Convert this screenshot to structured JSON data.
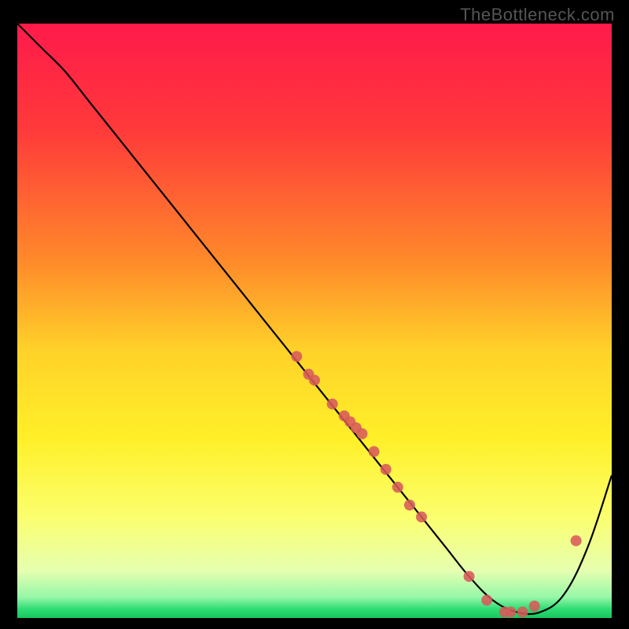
{
  "watermark": "TheBottleneck.com",
  "chart_data": {
    "type": "line",
    "title": "",
    "xlabel": "",
    "ylabel": "",
    "xlim": [
      0,
      100
    ],
    "ylim": [
      0,
      100
    ],
    "gradient_stops": [
      {
        "offset": 0.0,
        "color": "#ff1a4b"
      },
      {
        "offset": 0.18,
        "color": "#ff3a3a"
      },
      {
        "offset": 0.4,
        "color": "#ff8a2a"
      },
      {
        "offset": 0.55,
        "color": "#ffd229"
      },
      {
        "offset": 0.7,
        "color": "#fff029"
      },
      {
        "offset": 0.83,
        "color": "#fbff6e"
      },
      {
        "offset": 0.92,
        "color": "#e6ffb0"
      },
      {
        "offset": 0.965,
        "color": "#96f7a8"
      },
      {
        "offset": 0.985,
        "color": "#2edc74"
      },
      {
        "offset": 1.0,
        "color": "#18c75e"
      }
    ],
    "series": [
      {
        "name": "bottleneck-curve",
        "x": [
          0,
          4,
          8,
          12,
          16,
          20,
          24,
          28,
          32,
          36,
          40,
          44,
          48,
          52,
          56,
          60,
          64,
          68,
          72,
          76,
          80,
          84,
          88,
          92,
          96,
          100
        ],
        "y": [
          100,
          96,
          92,
          87,
          82,
          77,
          72,
          67,
          62,
          57,
          52,
          47,
          42,
          37,
          32,
          27,
          22,
          17,
          12,
          7,
          3,
          1,
          1,
          4,
          12,
          24
        ]
      }
    ],
    "markers": {
      "name": "highlight-points",
      "color": "#d75a5a",
      "radius": 7,
      "x": [
        47,
        49,
        50,
        53,
        55,
        56,
        57,
        58,
        60,
        62,
        64,
        66,
        68,
        76,
        79,
        82,
        83,
        85,
        87,
        94
      ],
      "y": [
        44,
        41,
        40,
        36,
        34,
        33,
        32,
        31,
        28,
        25,
        22,
        19,
        17,
        7,
        3,
        1,
        1,
        1,
        2,
        13
      ]
    }
  }
}
